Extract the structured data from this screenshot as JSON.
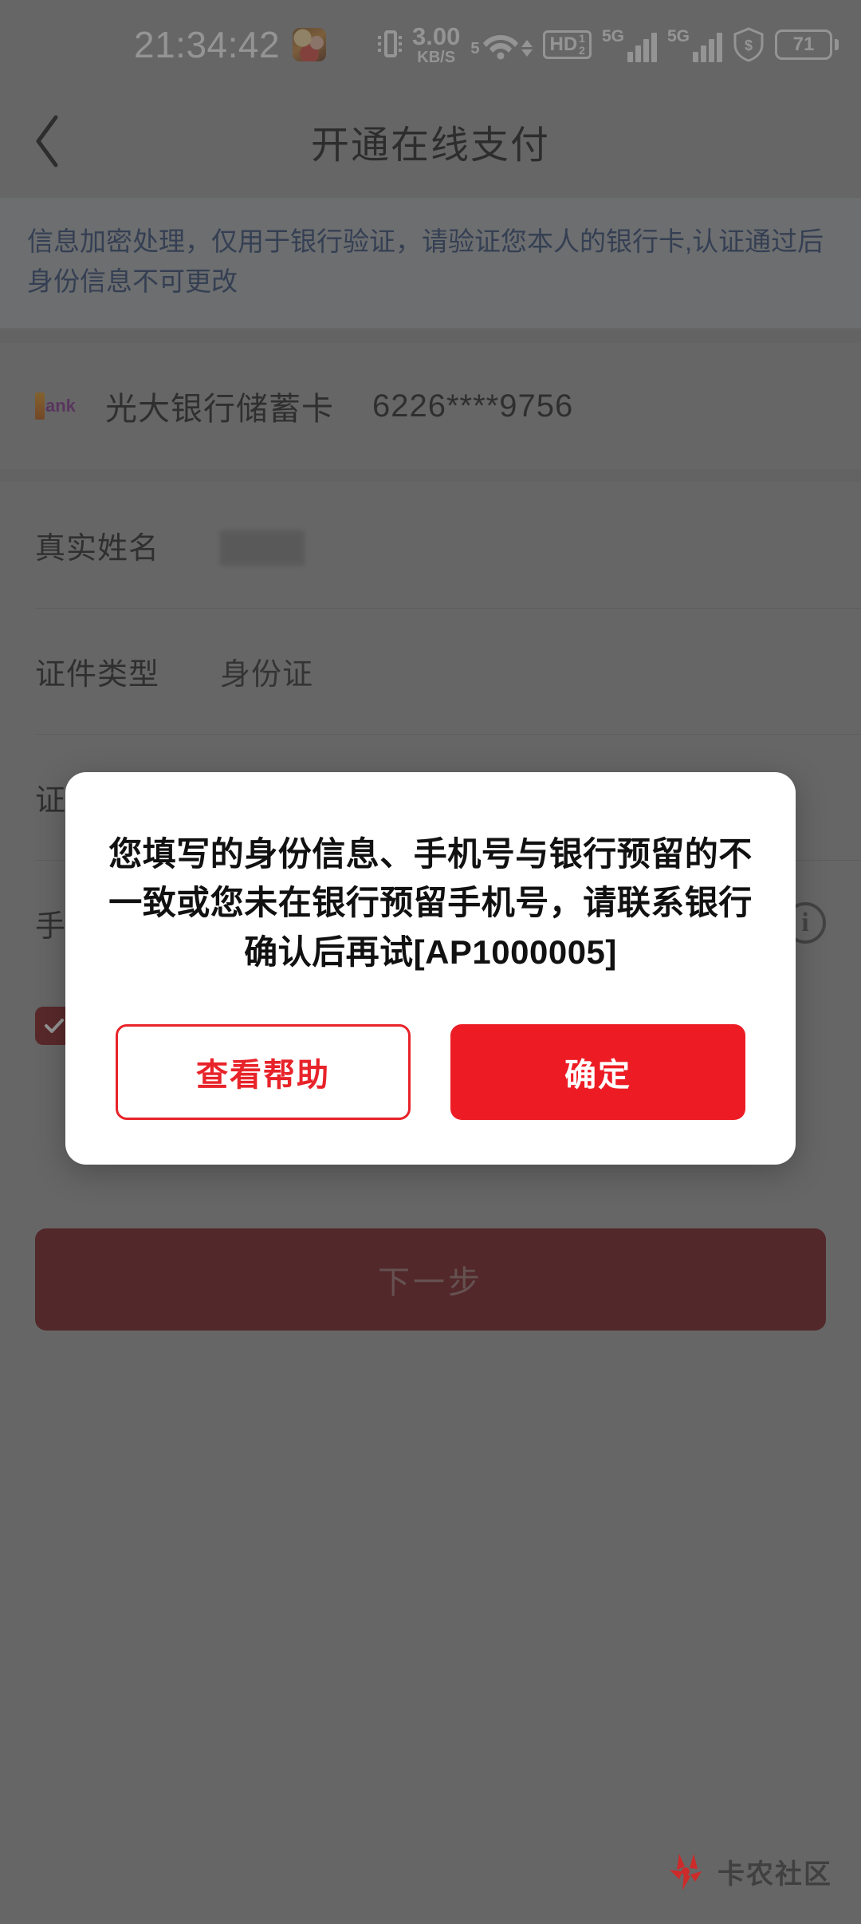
{
  "status_bar": {
    "time": "21:34:42",
    "app_icon": "game-app-icon",
    "vibrate_icon": "vibrate-icon",
    "net_speed_value": "3.00",
    "net_speed_unit": "KB/S",
    "wifi_label": "5",
    "wifi_icon": "wifi-icon",
    "hd_label": "HD",
    "hd_sim_top": "1",
    "hd_sim_bottom": "2",
    "sim1_gen": "5G",
    "sim2_gen": "5G",
    "shield_icon": "shield-dollar-icon",
    "battery_percent": "71"
  },
  "app_bar": {
    "back_icon": "back-chevron-icon",
    "title": "开通在线支付"
  },
  "notice": {
    "text": "信息加密处理，仅用于银行验证，请验证您本人的银行卡,认证通过后身份信息不可更改",
    "color": "#2d4470"
  },
  "bank_card": {
    "logo_icon": "bank-logo-icon",
    "logo_text": "ank",
    "name": "光大银行储蓄卡",
    "number": "6226****9756"
  },
  "form": {
    "rows": [
      {
        "label": "真实姓名",
        "value": "",
        "redacted": true,
        "info": false
      },
      {
        "label": "证件类型",
        "value": "身份证",
        "redacted": false,
        "info": false
      },
      {
        "label": "证件号码",
        "value": "",
        "redacted": false,
        "info": false
      },
      {
        "label": "手机号",
        "value": "",
        "redacted": false,
        "info": true,
        "info_icon": "info-circle-icon"
      }
    ]
  },
  "agreement": {
    "checkbox_icon": "checkmark-icon",
    "checked": true,
    "text": ""
  },
  "primary_action": {
    "label": "下一步",
    "background": "#6e1014",
    "text_color": "#9a6a6c"
  },
  "dialog": {
    "message": "您填写的身份信息、手机号与银行预留的不一致或您未在银行预留手机号，请联系银行确认后再试[AP1000005]",
    "secondary_label": "查看帮助",
    "primary_label": "确定",
    "accent_color": "#ed1c24"
  },
  "watermark": {
    "logo_icon": "kanong-logo-icon",
    "text": "卡农社区"
  }
}
